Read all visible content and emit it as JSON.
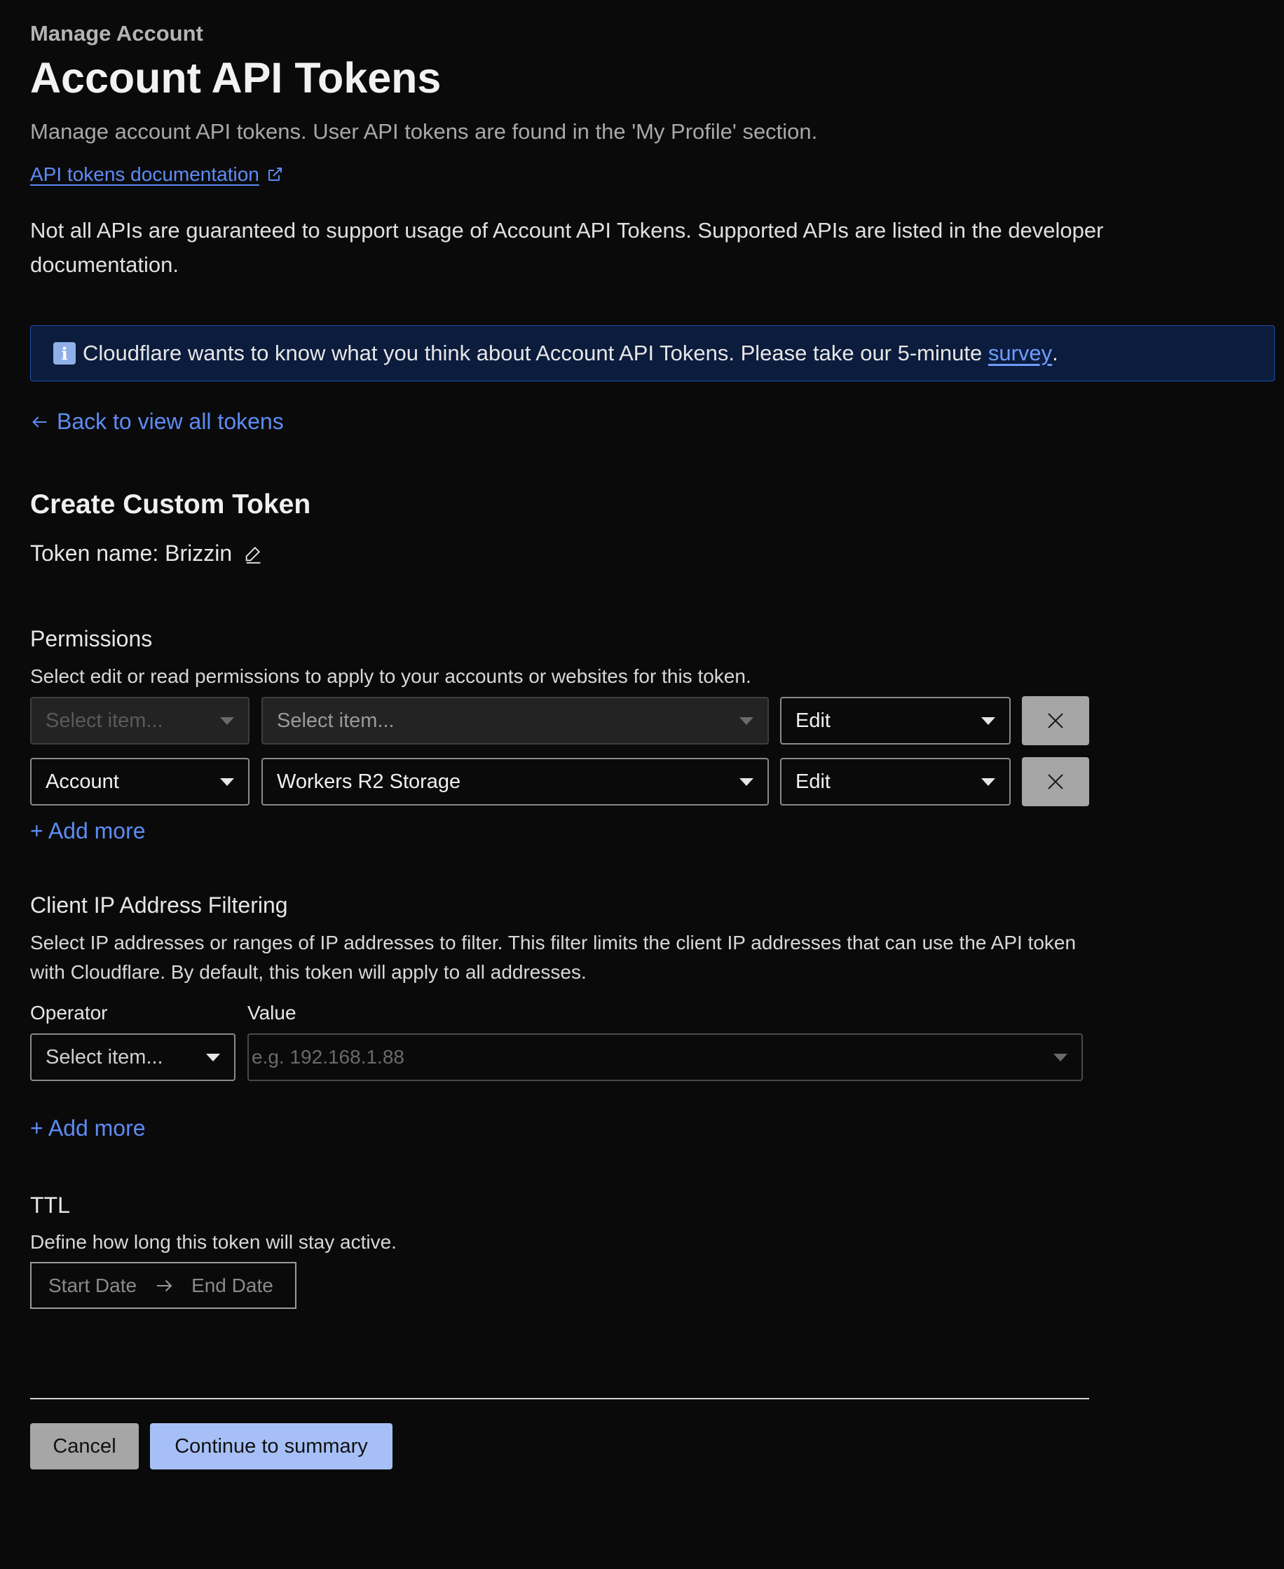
{
  "header": {
    "eyebrow": "Manage Account",
    "title": "Account API Tokens",
    "subtitle": "Manage account API tokens. User API tokens are found in the 'My Profile' section.",
    "doc_link": "API tokens documentation",
    "note": "Not all APIs are guaranteed to support usage of Account API Tokens. Supported APIs are listed in the developer documentation."
  },
  "banner": {
    "icon": "info-icon",
    "text": "Cloudflare wants to know what you think about Account API Tokens. Please take our 5-minute ",
    "link": "survey",
    "end": "."
  },
  "back_link": "Back to view all tokens",
  "form": {
    "heading": "Create Custom Token",
    "token_name_label": "Token name: ",
    "token_name": "Brizzin",
    "permissions": {
      "title": "Permissions",
      "description": "Select edit or read permissions to apply to your accounts or websites for this token.",
      "rows": [
        {
          "scope": "Select item...",
          "resource": "Select item...",
          "access": "Edit"
        },
        {
          "scope": "Account",
          "resource": "Workers R2 Storage",
          "access": "Edit"
        }
      ],
      "add_more": "Add more"
    },
    "ip_filtering": {
      "title": "Client IP Address Filtering",
      "description": "Select IP addresses or ranges of IP addresses to filter. This filter limits the client IP addresses that can use the API token with Cloudflare. By default, this token will apply to all addresses.",
      "operator_label": "Operator",
      "value_label": "Value",
      "operator_value": "Select item...",
      "value_placeholder": "e.g. 192.168.1.88",
      "add_more": "Add more"
    },
    "ttl": {
      "title": "TTL",
      "description": "Define how long this token will stay active.",
      "start_placeholder": "Start Date",
      "end_placeholder": "End Date"
    }
  },
  "actions": {
    "cancel": "Cancel",
    "continue": "Continue to summary"
  },
  "colors": {
    "background": "#0a0a0a",
    "link": "#5d8cf5",
    "banner_bg": "#0b1c3d",
    "banner_border": "#1f4ea8",
    "primary_button": "#a6c0f7",
    "secondary_button": "#a6a6a6"
  }
}
